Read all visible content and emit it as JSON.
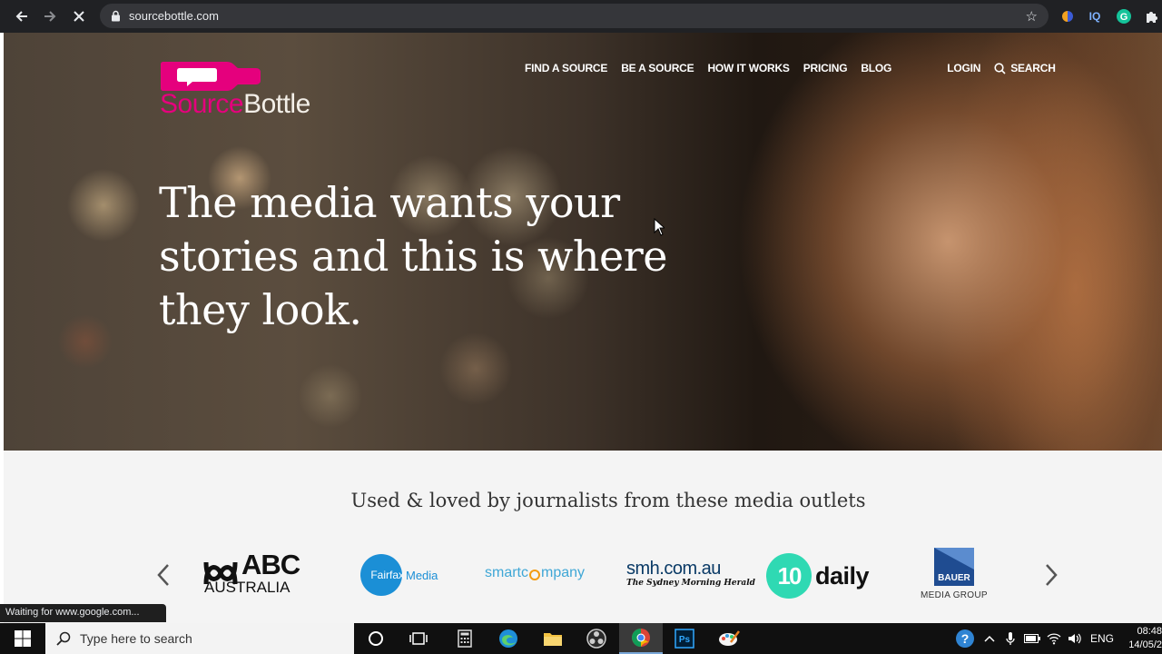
{
  "browser": {
    "url": "sourcebottle.com",
    "status_text": "Waiting for www.google.com..."
  },
  "logo": {
    "word1": "Source",
    "word2": "Bottle",
    "color": "#e5007d"
  },
  "nav": {
    "items": [
      "FIND A SOURCE",
      "BE A SOURCE",
      "HOW IT WORKS",
      "PRICING",
      "BLOG"
    ],
    "login": "LOGIN",
    "search": "SEARCH"
  },
  "hero": {
    "headline_line1": "The media wants your",
    "headline_line2": "stories and this is where",
    "headline_line3": "they look."
  },
  "outlets": {
    "tagline": "Used & loved by journalists from these media outlets",
    "abc": {
      "line1": "ABC",
      "line2": "AUSTRALIA"
    },
    "fairfax": {
      "part1": "Fairfax",
      "part2": "Media"
    },
    "smartcompany": {
      "part1": "smartc",
      "part2": "mpany"
    },
    "smh": {
      "line1": "smh.com.au",
      "line2": "The Sydney Morning Herald"
    },
    "tendaily": {
      "num": "10",
      "word": "daily"
    },
    "bauer": {
      "box": "BAUER",
      "line2": "MEDIA GROUP"
    }
  },
  "taskbar": {
    "search_placeholder": "Type here to search",
    "language": "ENG",
    "time": "08:48",
    "date": "14/05/2"
  }
}
